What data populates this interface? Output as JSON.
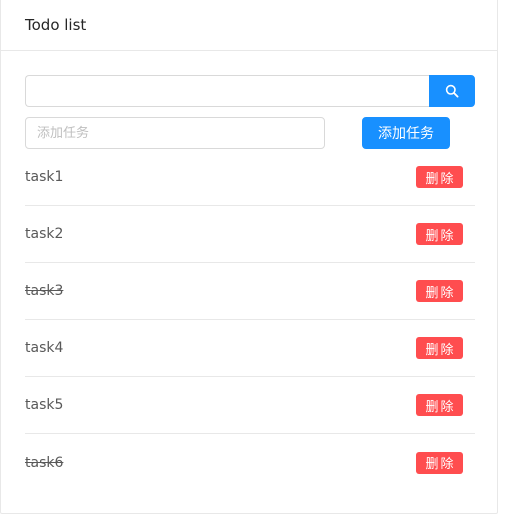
{
  "card": {
    "title": "Todo list"
  },
  "search": {
    "value": "",
    "icon": "search-icon"
  },
  "add": {
    "placeholder": "添加任务",
    "button_label": "添加任务"
  },
  "tasks": [
    {
      "label": "task1",
      "done": false,
      "delete_label": "删除"
    },
    {
      "label": "task2",
      "done": false,
      "delete_label": "删除"
    },
    {
      "label": "task3",
      "done": true,
      "delete_label": "删除"
    },
    {
      "label": "task4",
      "done": false,
      "delete_label": "删除"
    },
    {
      "label": "task5",
      "done": false,
      "delete_label": "删除"
    },
    {
      "label": "task6",
      "done": true,
      "delete_label": "删除"
    }
  ],
  "colors": {
    "primary": "#1890ff",
    "danger": "#ff4d4f",
    "border": "#e8e8e8"
  }
}
